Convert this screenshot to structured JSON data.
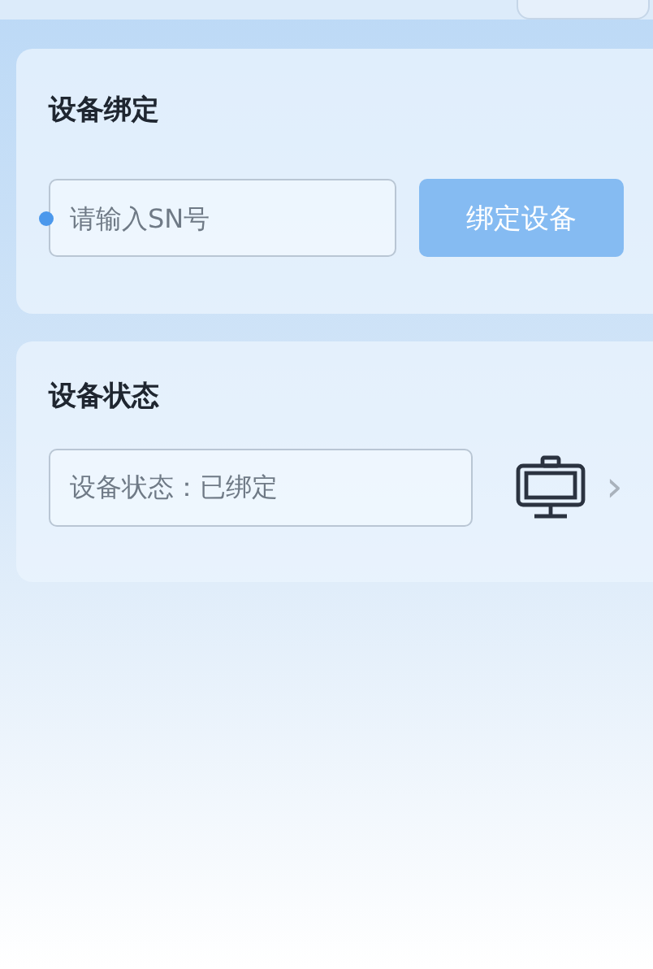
{
  "bind_card": {
    "title": "设备绑定",
    "sn_field": {
      "placeholder": "请输入SN号",
      "required": true
    },
    "bind_button": "绑定设备"
  },
  "status_card": {
    "title": "设备状态",
    "status_field": {
      "value": "设备状态：已绑定"
    },
    "chevron": "›"
  }
}
